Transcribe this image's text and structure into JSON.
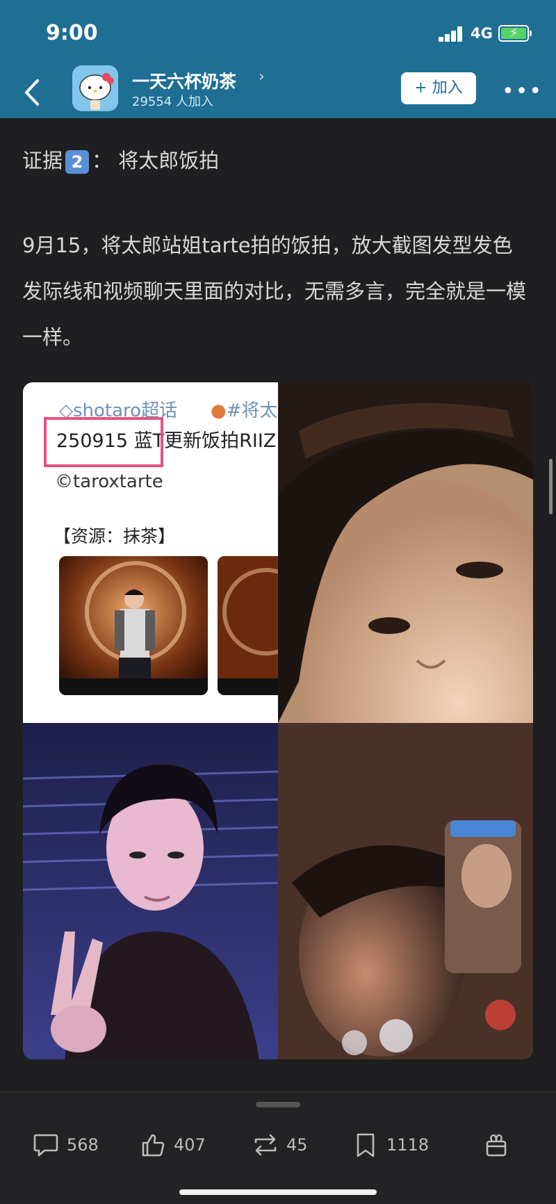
{
  "status": {
    "time": "9:00",
    "network": "4G"
  },
  "nav": {
    "group_name": "一天六杯奶茶",
    "member_count": "29554 人加入",
    "join_label": "+ 加入"
  },
  "post": {
    "evidence_prefix": "证据",
    "evidence_num": "2",
    "evidence_suffix": "： 将太郎饭拍",
    "paragraph": "9月15，将太郎站姐tarte拍的饭拍，放大截图发型发色 发际线和视频聊天里面的对比，无需多言，完全就是一模一样。"
  },
  "screenshot": {
    "tag1": "shotaro超话",
    "tag2": "#将太",
    "update_line": "250915 蓝T更新饭拍RIIZ",
    "credit": "taroxtarte",
    "resource": "【资源：抹茶】"
  },
  "actions": {
    "comments": "568",
    "likes": "407",
    "reposts": "45",
    "bookmarks": "1118"
  },
  "colors": {
    "header": "#1f6e94",
    "background": "#1f1f21",
    "highlight_box": "#e8507e",
    "battery": "#56d364"
  }
}
